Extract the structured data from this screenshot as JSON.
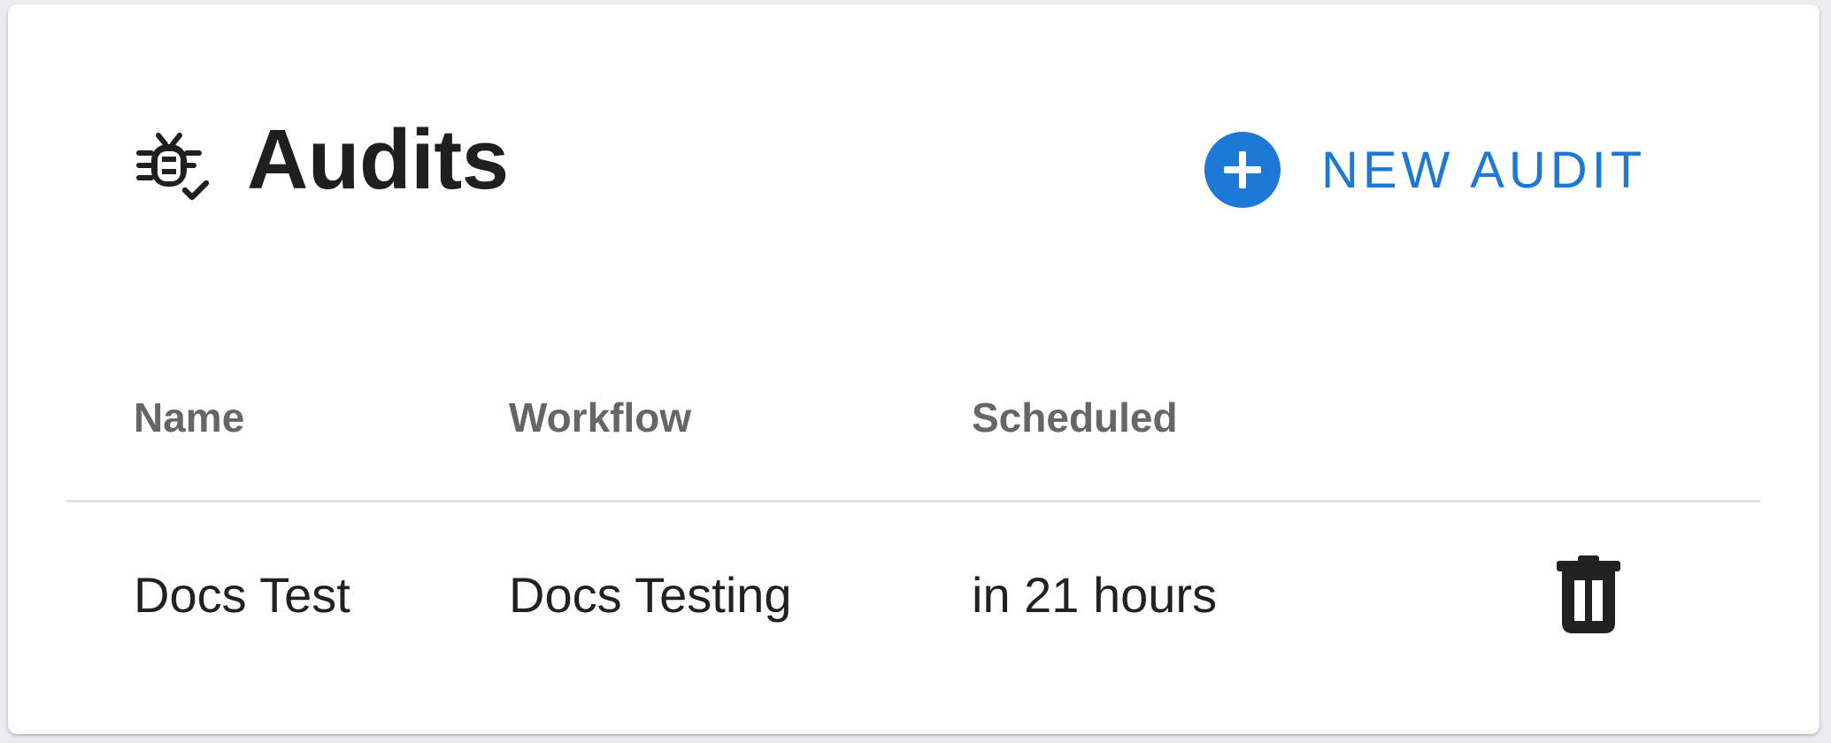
{
  "header": {
    "title": "Audits",
    "title_icon": "bug-check-icon",
    "new_audit_label": "NEW AUDIT",
    "new_audit_icon": "plus-circle-icon",
    "accent_color": "#1e78d6"
  },
  "table": {
    "columns": [
      "Name",
      "Workflow",
      "Scheduled"
    ],
    "rows": [
      {
        "name": "Docs Test",
        "workflow": "Docs Testing",
        "scheduled": "in 21 hours",
        "action_icon": "trash-icon"
      }
    ]
  }
}
